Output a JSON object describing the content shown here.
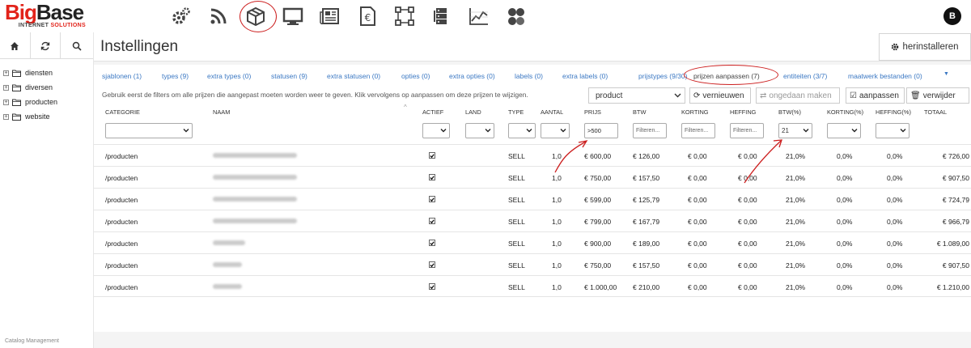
{
  "brand": {
    "name_red": "Big",
    "name_dark": "Base",
    "sub_dark": "INTERNET ",
    "sub_red": "SOLUTIONS"
  },
  "user": {
    "initial": "B"
  },
  "topnav": [
    {
      "name": "settings-gears-icon"
    },
    {
      "name": "rss-feed-icon"
    },
    {
      "name": "package-box-icon",
      "active": true
    },
    {
      "name": "monitor-icon"
    },
    {
      "name": "newspaper-icon"
    },
    {
      "name": "euro-document-icon"
    },
    {
      "name": "selection-frame-icon"
    },
    {
      "name": "server-stack-icon"
    },
    {
      "name": "line-chart-icon"
    },
    {
      "name": "users-group-icon"
    }
  ],
  "sidebar": {
    "tree": [
      {
        "label": "diensten"
      },
      {
        "label": "diversen"
      },
      {
        "label": "producten"
      },
      {
        "label": "website"
      }
    ],
    "footer": "Catalog Management"
  },
  "header": {
    "title": "Instellingen",
    "reinstall_label": "herinstalleren"
  },
  "tabs": [
    {
      "label": "sjablonen (1)"
    },
    {
      "label": "types (9)"
    },
    {
      "label": "extra types (0)"
    },
    {
      "label": "statusen (9)"
    },
    {
      "label": "extra statusen (0)"
    },
    {
      "label": "opties (0)"
    },
    {
      "label": "extra opties (0)"
    },
    {
      "label": "labels (0)"
    },
    {
      "label": "extra labels (0)"
    },
    {
      "label": "prijstypes (9/30)"
    },
    {
      "label": "prijzen aanpassen (7)",
      "active": true
    },
    {
      "label": "entiteiten (3/7)"
    },
    {
      "label": "maatwerk bestanden (0)"
    }
  ],
  "toolbar": {
    "hint": "Gebruik eerst de filters om alle prijzen die aangepast moeten worden weer te geven. Klik vervolgens op aanpassen om deze prijzen te wijzigen.",
    "product_select": "product",
    "refresh_label": "vernieuwen",
    "undo_label": "ongedaan maken",
    "apply_label": "aanpassen",
    "delete_label": "verwijder"
  },
  "table": {
    "columns": [
      "CATEGORIE",
      "NAAM",
      "ACTIEF",
      "LAND",
      "TYPE",
      "AANTAL",
      "PRIJS",
      "BTW",
      "KORTING",
      "HEFFING",
      "BTW(%)",
      "KORTING(%)",
      "HEFFING(%)",
      "TOTAAL"
    ],
    "filters": {
      "prijs": ">500",
      "btw_placeholder": "Filteren...",
      "korting_placeholder": "Filteren...",
      "heffing_placeholder": "Filteren...",
      "btw_pct": "21"
    },
    "rows": [
      {
        "categorie": "/producten",
        "actief": true,
        "type": "SELL",
        "aantal": "1,0",
        "prijs": "€ 600,00",
        "btw": "€ 126,00",
        "korting": "€ 0,00",
        "heffing": "€ 0,00",
        "btw_pct": "21,0%",
        "korting_pct": "0,0%",
        "heffing_pct": "0,0%",
        "totaal": "€ 726,00"
      },
      {
        "categorie": "/producten",
        "actief": true,
        "type": "SELL",
        "aantal": "1,0",
        "prijs": "€ 750,00",
        "btw": "€ 157,50",
        "korting": "€ 0,00",
        "heffing": "€ 0,00",
        "btw_pct": "21,0%",
        "korting_pct": "0,0%",
        "heffing_pct": "0,0%",
        "totaal": "€ 907,50"
      },
      {
        "categorie": "/producten",
        "actief": true,
        "type": "SELL",
        "aantal": "1,0",
        "prijs": "€ 599,00",
        "btw": "€ 125,79",
        "korting": "€ 0,00",
        "heffing": "€ 0,00",
        "btw_pct": "21,0%",
        "korting_pct": "0,0%",
        "heffing_pct": "0,0%",
        "totaal": "€ 724,79"
      },
      {
        "categorie": "/producten",
        "actief": true,
        "type": "SELL",
        "aantal": "1,0",
        "prijs": "€ 799,00",
        "btw": "€ 167,79",
        "korting": "€ 0,00",
        "heffing": "€ 0,00",
        "btw_pct": "21,0%",
        "korting_pct": "0,0%",
        "heffing_pct": "0,0%",
        "totaal": "€ 966,79"
      },
      {
        "categorie": "/producten",
        "actief": true,
        "type": "SELL",
        "aantal": "1,0",
        "prijs": "€ 900,00",
        "btw": "€ 189,00",
        "korting": "€ 0,00",
        "heffing": "€ 0,00",
        "btw_pct": "21,0%",
        "korting_pct": "0,0%",
        "heffing_pct": "0,0%",
        "totaal": "€ 1.089,00"
      },
      {
        "categorie": "/producten",
        "actief": true,
        "type": "SELL",
        "aantal": "1,0",
        "prijs": "€ 750,00",
        "btw": "€ 157,50",
        "korting": "€ 0,00",
        "heffing": "€ 0,00",
        "btw_pct": "21,0%",
        "korting_pct": "0,0%",
        "heffing_pct": "0,0%",
        "totaal": "€ 907,50"
      },
      {
        "categorie": "/producten",
        "actief": true,
        "type": "SELL",
        "aantal": "1,0",
        "prijs": "€ 1.000,00",
        "btw": "€ 210,00",
        "korting": "€ 0,00",
        "heffing": "€ 0,00",
        "btw_pct": "21,0%",
        "korting_pct": "0,0%",
        "heffing_pct": "0,0%",
        "totaal": "€ 1.210,00"
      }
    ]
  },
  "colors": {
    "brand_red": "#e2231a",
    "link_blue": "#3b78c3",
    "annotation_red": "#cc1f1f"
  }
}
